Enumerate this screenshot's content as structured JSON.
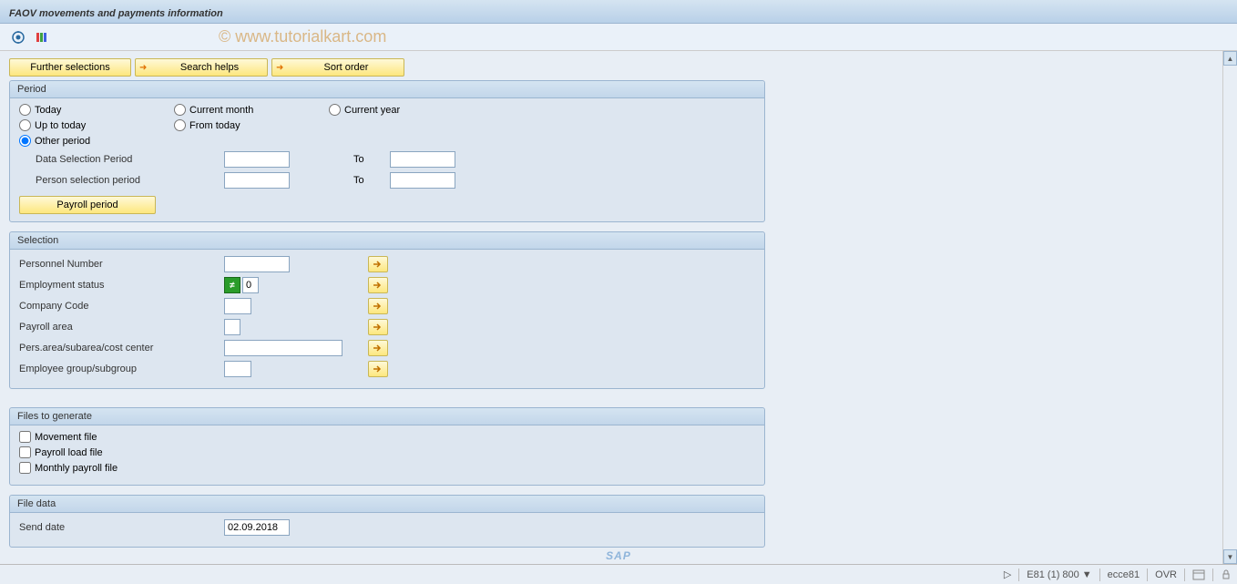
{
  "title": "FAOV movements and payments information",
  "watermark": "© www.tutorialkart.com",
  "toolbar": {
    "further_selections": "Further selections",
    "search_helps": "Search helps",
    "sort_order": "Sort order"
  },
  "period": {
    "group_title": "Period",
    "today": "Today",
    "current_month": "Current month",
    "current_year": "Current year",
    "up_to_today": "Up to today",
    "from_today": "From today",
    "other_period": "Other period",
    "data_selection_period": "Data Selection Period",
    "person_selection_period": "Person selection period",
    "to": "To",
    "payroll_period": "Payroll period",
    "data_from": "",
    "data_to": "",
    "person_from": "",
    "person_to": ""
  },
  "selection": {
    "group_title": "Selection",
    "personnel_number": "Personnel Number",
    "employment_status": "Employment status",
    "company_code": "Company Code",
    "payroll_area": "Payroll area",
    "pers_area": "Pers.area/subarea/cost center",
    "employee_group": "Employee group/subgroup",
    "emp_status_val": "0",
    "not_equal": "≠"
  },
  "files": {
    "group_title": "Files to generate",
    "movement_file": "Movement file",
    "payroll_load_file": "Payroll load file",
    "monthly_payroll_file": "Monthly payroll file"
  },
  "file_data": {
    "group_title": "File data",
    "send_date": "Send date",
    "send_date_val": "02.09.2018"
  },
  "status": {
    "system": "E81 (1) 800",
    "server": "ecce81",
    "mode": "OVR"
  },
  "sap": "SAP"
}
